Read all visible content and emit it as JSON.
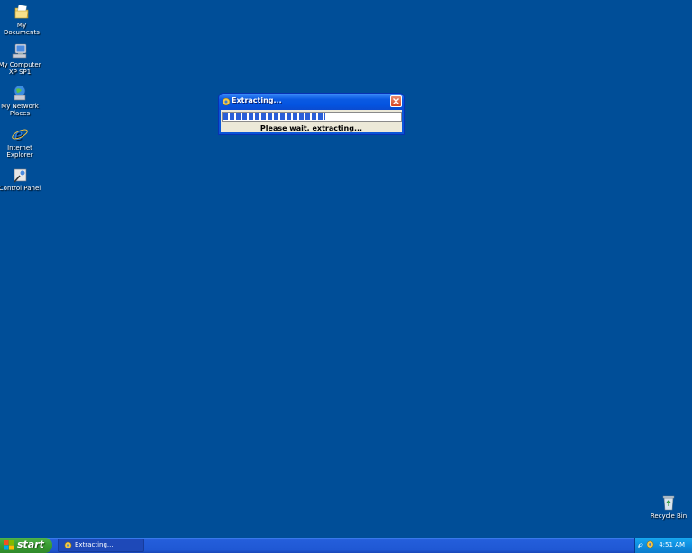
{
  "desktop": {
    "background": "#004e98",
    "icons": [
      {
        "label": "My Documents",
        "icon": "my-documents-folder-icon"
      },
      {
        "label": "My Computer\nXP SP1",
        "icon": "my-computer-icon"
      },
      {
        "label": "My Network\nPlaces",
        "icon": "network-places-icon"
      },
      {
        "label": "Internet\nExplorer",
        "icon": "internet-explorer-icon"
      },
      {
        "label": "Control Panel",
        "icon": "control-panel-icon"
      },
      {
        "label": "Recycle Bin",
        "icon": "recycle-bin-icon"
      }
    ]
  },
  "dialog": {
    "title": "Extracting...",
    "status": "Please wait, extracting...",
    "progress_percent": 57,
    "close_icon": "close-icon"
  },
  "taskbar": {
    "start_label": "start",
    "task_label": "Extracting...",
    "clock": "4:51 AM"
  },
  "colors": {
    "titlebar": "#0a5ae3",
    "client": "#ece9d8",
    "progress": "#2a5fd8",
    "start": "#3a9c33",
    "tray": "#0f8fe0"
  }
}
